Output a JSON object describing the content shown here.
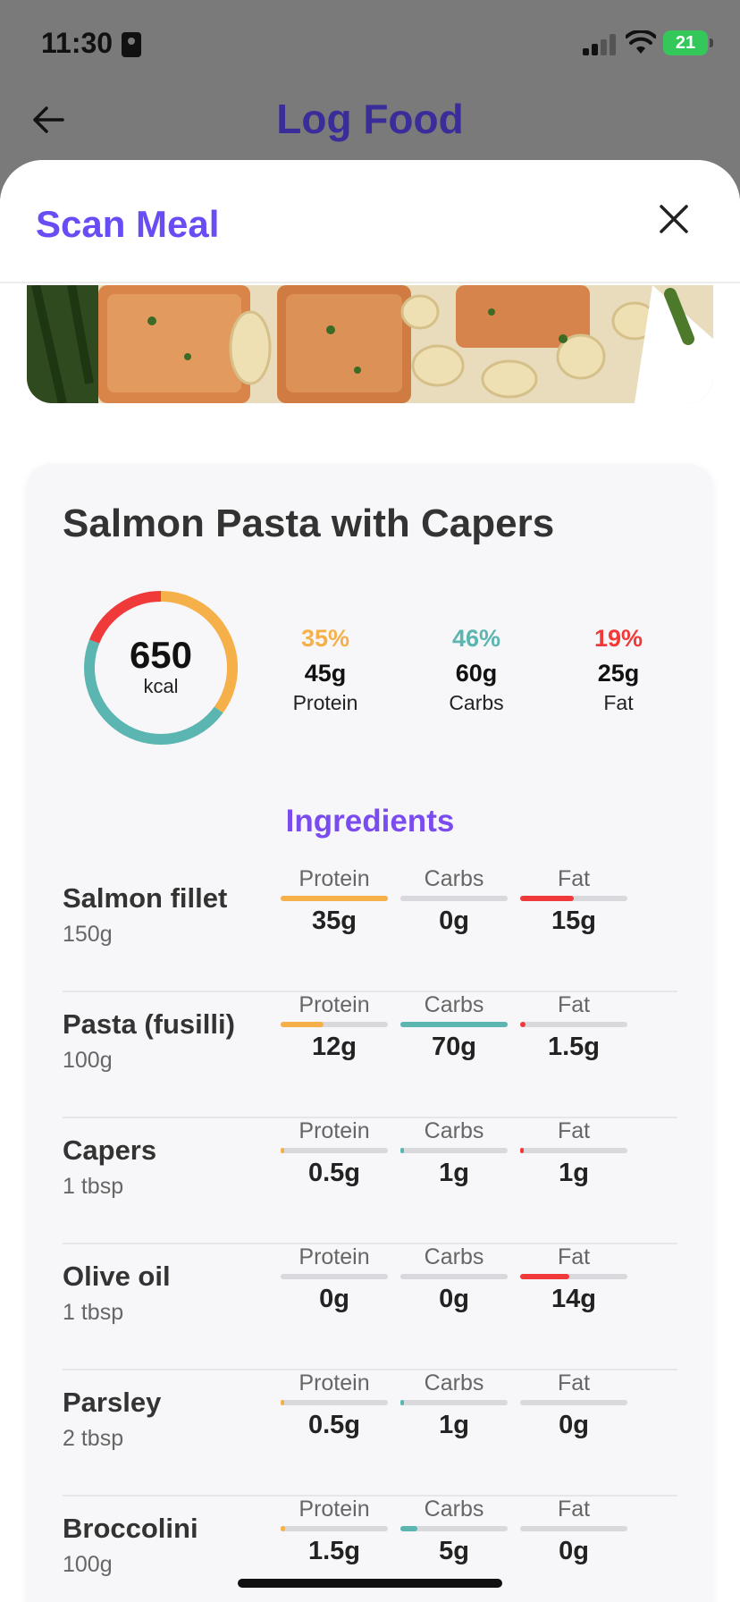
{
  "status": {
    "time": "11:30",
    "battery": "21"
  },
  "nav": {
    "title": "Log Food"
  },
  "sheet": {
    "title": "Scan Meal"
  },
  "meal": {
    "name": "Salmon Pasta with Capers",
    "kcal": "650",
    "kcal_unit": "kcal",
    "macros": [
      {
        "pct": "35%",
        "grams": "45g",
        "label": "Protein",
        "color": "#f5b04a"
      },
      {
        "pct": "46%",
        "grams": "60g",
        "label": "Carbs",
        "color": "#5bb5b0"
      },
      {
        "pct": "19%",
        "grams": "25g",
        "label": "Fat",
        "color": "#f03a3a"
      }
    ]
  },
  "ingredients_title": "Ingredients",
  "ingredients": [
    {
      "name": "Salmon fillet",
      "qty": "150g",
      "protein": {
        "label": "Protein",
        "value": "35g",
        "level": 1.0
      },
      "carbs": {
        "label": "Carbs",
        "value": "0g",
        "level": 0.0
      },
      "fat": {
        "label": "Fat",
        "value": "15g",
        "level": 0.5
      }
    },
    {
      "name": "Pasta (fusilli)",
      "qty": "100g",
      "protein": {
        "label": "Protein",
        "value": "12g",
        "level": 0.4
      },
      "carbs": {
        "label": "Carbs",
        "value": "70g",
        "level": 1.0
      },
      "fat": {
        "label": "Fat",
        "value": "1.5g",
        "level": 0.05
      }
    },
    {
      "name": "Capers",
      "qty": "1 tbsp",
      "protein": {
        "label": "Protein",
        "value": "0.5g",
        "level": 0.02
      },
      "carbs": {
        "label": "Carbs",
        "value": "1g",
        "level": 0.03
      },
      "fat": {
        "label": "Fat",
        "value": "1g",
        "level": 0.03
      }
    },
    {
      "name": "Olive oil",
      "qty": "1 tbsp",
      "protein": {
        "label": "Protein",
        "value": "0g",
        "level": 0.0
      },
      "carbs": {
        "label": "Carbs",
        "value": "0g",
        "level": 0.0
      },
      "fat": {
        "label": "Fat",
        "value": "14g",
        "level": 0.46
      }
    },
    {
      "name": "Parsley",
      "qty": "2 tbsp",
      "protein": {
        "label": "Protein",
        "value": "0.5g",
        "level": 0.02
      },
      "carbs": {
        "label": "Carbs",
        "value": "1g",
        "level": 0.03
      },
      "fat": {
        "label": "Fat",
        "value": "0g",
        "level": 0.0
      }
    },
    {
      "name": "Broccolini",
      "qty": "100g",
      "protein": {
        "label": "Protein",
        "value": "1.5g",
        "level": 0.04
      },
      "carbs": {
        "label": "Carbs",
        "value": "5g",
        "level": 0.16
      },
      "fat": {
        "label": "Fat",
        "value": "0g",
        "level": 0.0
      }
    }
  ],
  "icons": {
    "back": "arrow-left-icon",
    "close": "close-icon",
    "signal": "signal-icon",
    "wifi": "wifi-icon",
    "battery": "battery-icon",
    "id": "id-card-icon"
  }
}
